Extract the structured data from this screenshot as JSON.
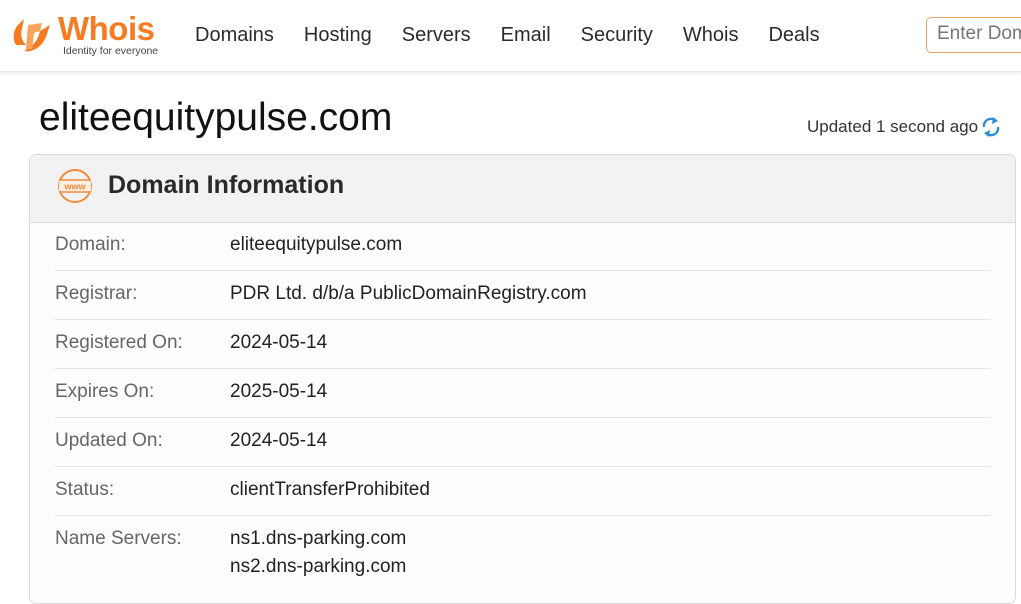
{
  "header": {
    "logo_text": "Whois",
    "logo_tagline": "Identity for everyone",
    "nav": [
      "Domains",
      "Hosting",
      "Servers",
      "Email",
      "Security",
      "Whois",
      "Deals"
    ],
    "search_placeholder": "Enter Domain or IP"
  },
  "page": {
    "domain_title": "eliteequitypulse.com",
    "updated_text": "Updated 1 second ago"
  },
  "card": {
    "title": "Domain Information",
    "icon_text": "www",
    "rows": [
      {
        "label": "Domain:",
        "value": "eliteequitypulse.com"
      },
      {
        "label": "Registrar:",
        "value": "PDR Ltd. d/b/a PublicDomainRegistry.com"
      },
      {
        "label": "Registered On:",
        "value": "2024-05-14"
      },
      {
        "label": "Expires On:",
        "value": "2025-05-14"
      },
      {
        "label": "Updated On:",
        "value": "2024-05-14"
      },
      {
        "label": "Status:",
        "value": "clientTransferProhibited"
      }
    ],
    "name_servers": {
      "label": "Name Servers:",
      "values": [
        "ns1.dns-parking.com",
        "ns2.dns-parking.com"
      ]
    }
  },
  "colors": {
    "brand_orange": "#f57c20",
    "refresh_blue": "#2b8fd6"
  },
  "icons": [
    "whois-logo-icon",
    "refresh-icon",
    "www-icon"
  ]
}
